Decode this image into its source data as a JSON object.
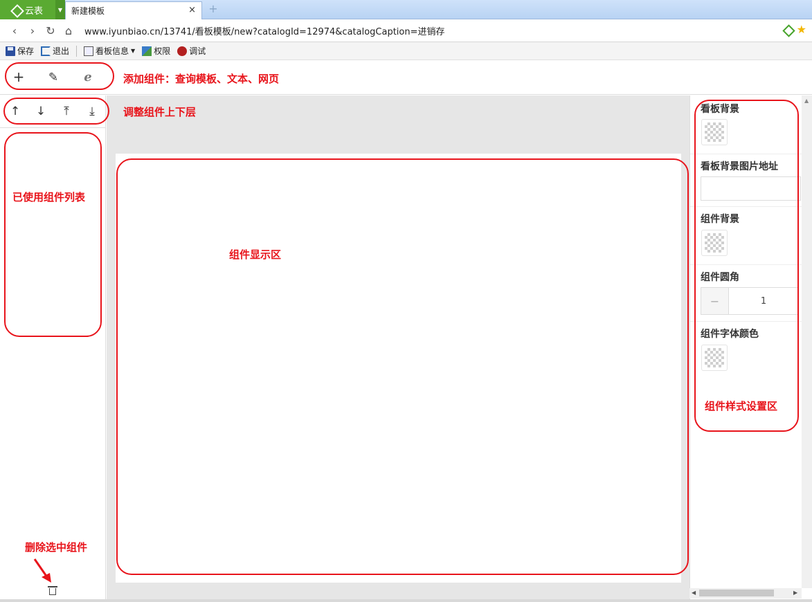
{
  "browser": {
    "brand": "云表",
    "tab_title": "新建模板",
    "tab_close": "×",
    "new_tab": "+",
    "url": "www.iyunbiao.cn/13741/看板模板/new?catalogId=12974&catalogCaption=进销存"
  },
  "toolbar": {
    "save": "保存",
    "exit": "退出",
    "board_info": "看板信息",
    "permission": "权限",
    "debug": "调试"
  },
  "icons": {
    "add": "+",
    "text": "✎",
    "web": "e",
    "up": "↑",
    "down": "↓",
    "top": "⤒",
    "bottom": "⤓"
  },
  "annotations": {
    "add_component": "添加组件：查询模板、文本、网页",
    "adjust_layer": "调整组件上下层",
    "used_list": "已使用组件列表",
    "display_area": "组件显示区",
    "style_area": "组件样式设置区",
    "delete_selected": "删除选中组件"
  },
  "properties": {
    "board_bg": "看板背景",
    "board_bg_url": "看板背景图片地址",
    "board_bg_url_value": "",
    "component_bg": "组件背景",
    "component_radius": "组件圆角",
    "radius_minus": "−",
    "radius_value": "1",
    "font_color": "组件字体颜色"
  },
  "colors": {
    "annotation": "#e8141b",
    "brand_green": "#5aaa32",
    "canvas_bg": "#e6e6e6"
  }
}
